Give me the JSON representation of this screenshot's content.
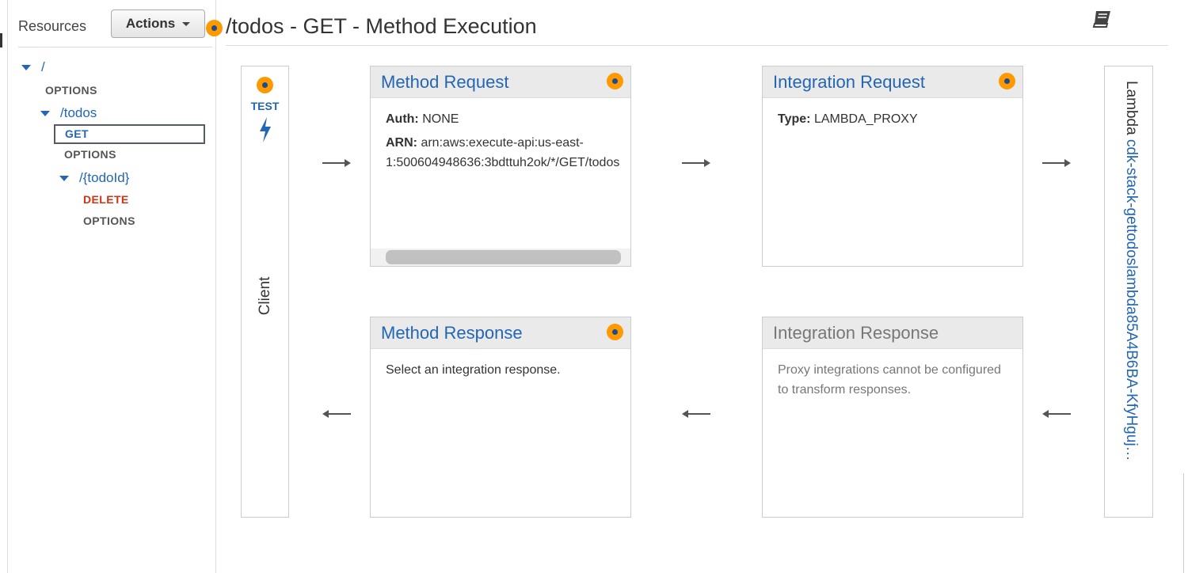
{
  "sidebar": {
    "title": "Resources",
    "actions_label": "Actions",
    "tree": {
      "root": "/",
      "root_options": "OPTIONS",
      "todos": "/todos",
      "todos_get": "GET",
      "todos_options": "OPTIONS",
      "todoid": "/{todoId}",
      "todoid_delete": "DELETE",
      "todoid_options": "OPTIONS"
    }
  },
  "page": {
    "title": "/todos - GET - Method Execution"
  },
  "client": {
    "test_label": "TEST",
    "label": "Client"
  },
  "method_request": {
    "title": "Method Request",
    "auth_label": "Auth:",
    "auth_value": "NONE",
    "arn_label": "ARN:",
    "arn_line1": "arn:aws:execute-api:us-east-",
    "arn_line2": "1:500604948636:3bdttuh2ok/*/GET/todos"
  },
  "integration_request": {
    "title": "Integration Request",
    "type_label": "Type:",
    "type_value": "LAMBDA_PROXY"
  },
  "method_response": {
    "title": "Method Response",
    "body": "Select an integration response."
  },
  "integration_response": {
    "title": "Integration Response",
    "body_line1": "Proxy integrations cannot be configured",
    "body_line2": "to transform responses."
  },
  "lambda": {
    "prefix": "Lambda",
    "function_name": "cdk-stack-gettodoslambda85A4B6BA-KfyHguj…"
  },
  "colors": {
    "accent_orange": "#ff9900",
    "link_blue": "#2266b4",
    "delete_red": "#d13212"
  }
}
